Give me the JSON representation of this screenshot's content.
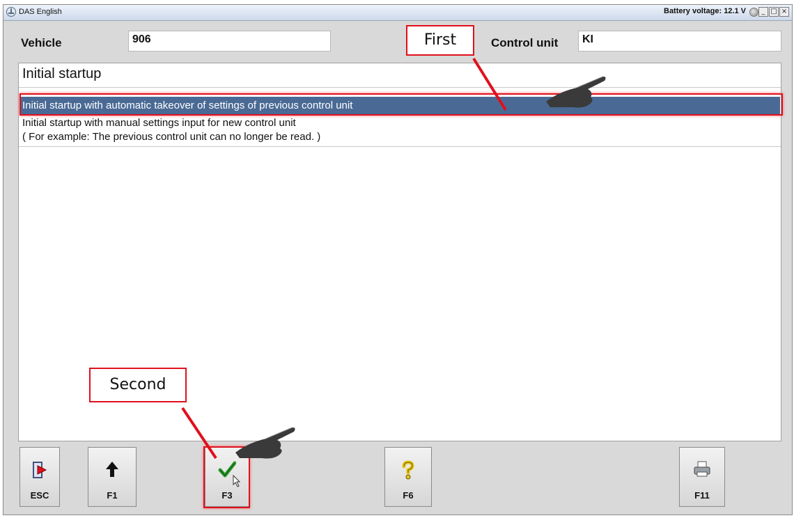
{
  "window": {
    "title": "DAS English",
    "battery": "Battery voltage: 12.1 V",
    "minimize": "_",
    "maximize": "□",
    "close": "×"
  },
  "header": {
    "vehicle_label": "Vehicle",
    "vehicle_value": "906",
    "control_unit_label": "Control unit",
    "control_unit_value": "KI"
  },
  "list": {
    "heading": "Initial startup",
    "items": [
      "Initial startup with automatic takeover of settings of previous control unit",
      "Initial startup with manual settings input for new control unit",
      "( For example: The previous control unit can no longer be read. )"
    ],
    "selected_index": 0
  },
  "annotations": {
    "first": "First",
    "second": "Second"
  },
  "toolbar": {
    "keys": [
      {
        "label": "ESC",
        "icon": "exit-door-icon"
      },
      {
        "label": "F1",
        "icon": "arrow-up-icon"
      },
      {
        "label": "F3",
        "icon": "checkmark-icon"
      },
      {
        "label": "F6",
        "icon": "help-icon"
      },
      {
        "label": "F11",
        "icon": "printer-icon"
      }
    ]
  },
  "colors": {
    "selection": "#4a6a95",
    "highlight": "#e0101c",
    "check": "#2a9a2a",
    "help": "#e6c619"
  }
}
